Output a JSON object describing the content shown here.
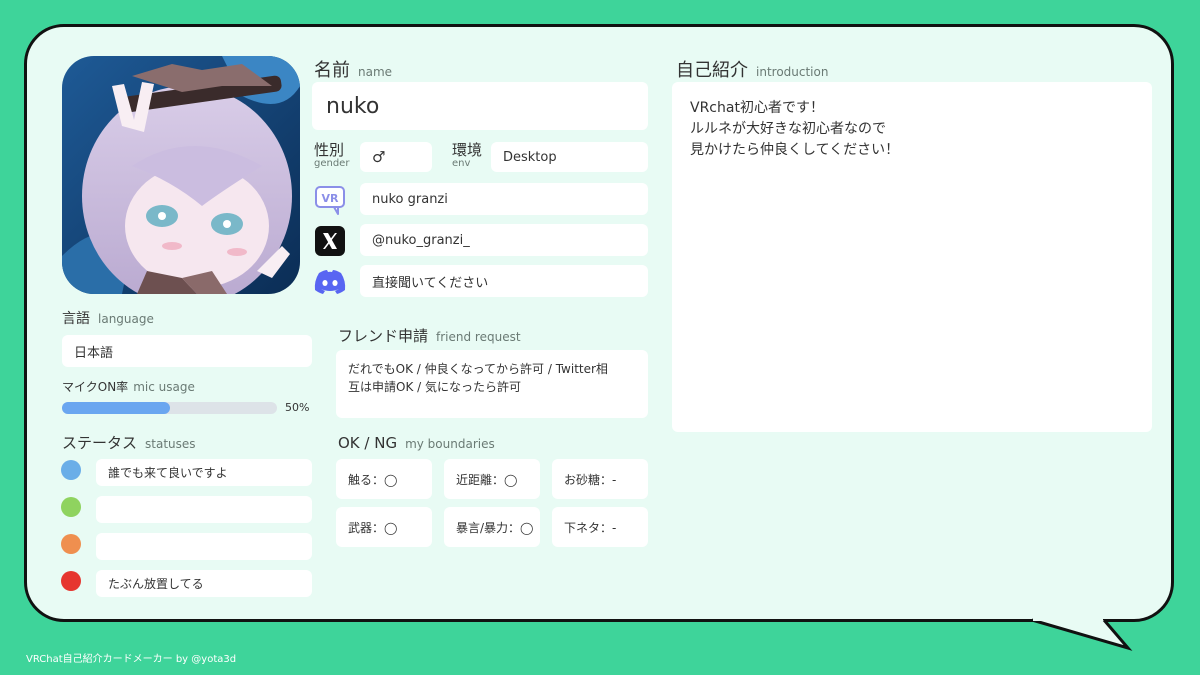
{
  "name": {
    "label": "名前",
    "sublabel": "name",
    "value": "nuko"
  },
  "gender": {
    "label": "性別",
    "sublabel": "gender",
    "value": "♂"
  },
  "env": {
    "label": "環境",
    "sublabel": "env",
    "value": "Desktop"
  },
  "accounts": {
    "vrchat": "nuko granzi",
    "x": "@nuko_granzi_",
    "discord": "直接聞いてください"
  },
  "language": {
    "label": "言語",
    "sublabel": "language",
    "value": "日本語"
  },
  "mic": {
    "label": "マイクON率",
    "sublabel": "mic usage",
    "percent": 50,
    "percent_text": "50%"
  },
  "statuses": {
    "label": "ステータス",
    "sublabel": "statuses",
    "items": [
      {
        "color": "#6aaee8",
        "text": "誰でも来て良いですよ"
      },
      {
        "color": "#8fd35f",
        "text": ""
      },
      {
        "color": "#ef8f4f",
        "text": ""
      },
      {
        "color": "#e6362f",
        "text": "たぶん放置してる"
      }
    ]
  },
  "friend_request": {
    "label": "フレンド申請",
    "sublabel": "friend request",
    "line1": "だれでもOK / 仲良くなってから許可 / Twitter相",
    "line2": "互は申請OK / 気になったら許可"
  },
  "boundaries": {
    "label": "OK / NG",
    "sublabel": "my boundaries",
    "items": [
      "触る：◯",
      "近距離：◯",
      "お砂糖：-",
      "武器：◯",
      "暴言/暴力：◯",
      "下ネタ：-"
    ]
  },
  "intro": {
    "label": "自己紹介",
    "sublabel": "introduction",
    "lines": [
      "VRchat初心者です！",
      "ルルネが大好きな初心者なので",
      "見かけたら仲良くしてください！"
    ]
  },
  "footer": "VRChat自己紹介カードメーカー by @yota3d",
  "icons": {
    "vrchat": "vrchat-icon",
    "x": "x-logo-icon",
    "discord": "discord-icon"
  }
}
